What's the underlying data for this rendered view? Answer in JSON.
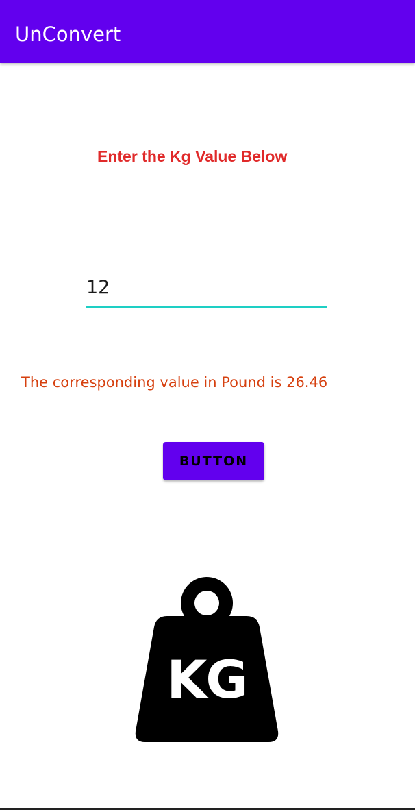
{
  "app_bar": {
    "title": "UnConvert",
    "color": "#6200ee"
  },
  "form": {
    "prompt": "Enter the Kg Value Below",
    "prompt_color": "#e02a2a",
    "input_value": "12",
    "input_underline_color": "#1ecfc4"
  },
  "result": {
    "text": "The corresponding value in Pound is 26.46",
    "color": "#d6400f"
  },
  "button": {
    "label": "BUTTON",
    "color": "#6200ee"
  },
  "image": {
    "icon": "kg-weight-icon",
    "label": "KG"
  }
}
